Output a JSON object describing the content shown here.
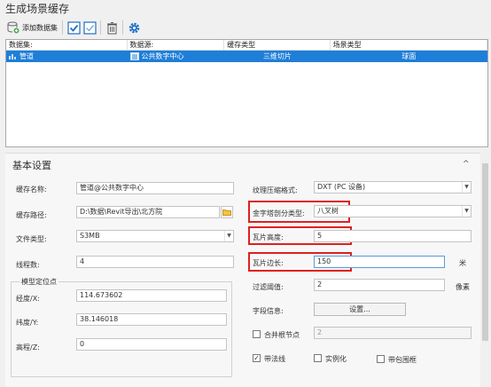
{
  "window": {
    "title": "生成场景缓存"
  },
  "toolbar": {
    "add_dataset_label": "添加数据集"
  },
  "grid": {
    "columns": [
      "数据集:",
      "数据源:",
      "缓存类型",
      "场景类型"
    ],
    "rows": [
      {
        "dataset": "管道",
        "datasource": "公共数字中心",
        "cache_type": "三维切片",
        "scene_type": "球面"
      }
    ]
  },
  "panel": {
    "title": "基本设置",
    "cache_name": {
      "label": "缓存名称:",
      "value": "管道@公共数字中心"
    },
    "cache_path": {
      "label": "缓存路径:",
      "value": "D:\\数据\\Revit导出\\北方院"
    },
    "file_type": {
      "label": "文件类型:",
      "value": "S3MB"
    },
    "thread_count": {
      "label": "线程数:",
      "value": "4"
    },
    "texture_format": {
      "label": "纹理压缩格式:",
      "value": "DXT (PC 设备)"
    },
    "pyramid_type": {
      "label": "金字塔剖分类型:",
      "value": "八叉树"
    },
    "tile_height": {
      "label": "瓦片高度:",
      "value": "5"
    },
    "tile_edge": {
      "label": "瓦片边长:",
      "value": "150",
      "unit": "米"
    },
    "filter_threshold": {
      "label": "过滤阈值:",
      "value": "2",
      "unit": "像素"
    },
    "field_info": {
      "label": "字段信息:",
      "button": "设置..."
    },
    "merge_nodes": {
      "label": "合并根节点",
      "value": "2",
      "checked": false
    },
    "normals": {
      "label": "带法线",
      "checked": true
    },
    "instancing": {
      "label": "实例化",
      "checked": false
    },
    "bbox": {
      "label": "带包围框",
      "checked": false
    },
    "position_group": {
      "legend": "模型定位点",
      "x": {
        "label": "经度/X:",
        "value": "114.673602"
      },
      "y": {
        "label": "纬度/Y:",
        "value": "38.146018"
      },
      "z": {
        "label": "高程/Z:",
        "value": "0"
      }
    }
  }
}
